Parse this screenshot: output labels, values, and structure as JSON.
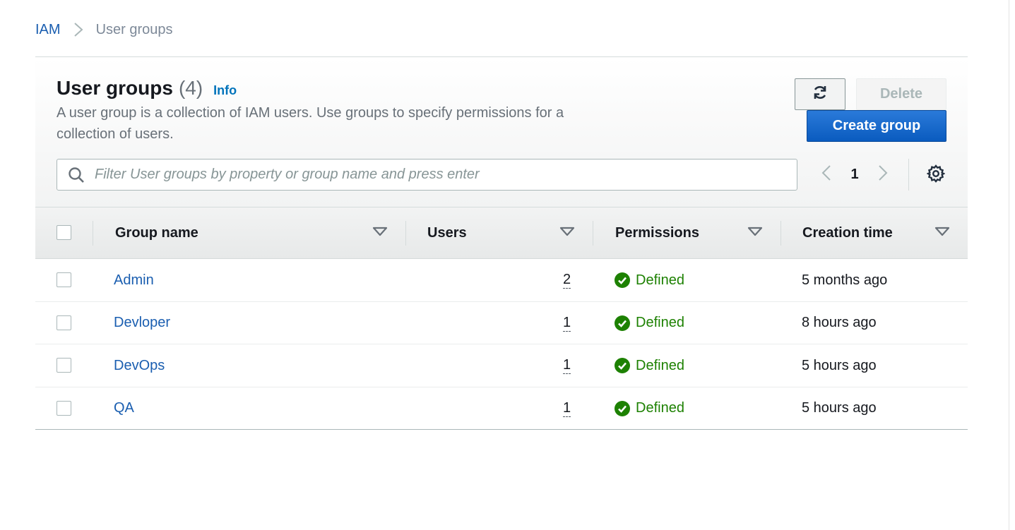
{
  "breadcrumb": {
    "root": "IAM",
    "current": "User groups"
  },
  "header": {
    "title": "User groups",
    "count": "(4)",
    "info": "Info",
    "description": "A user group is a collection of IAM users. Use groups to specify permissions for a collection of users."
  },
  "actions": {
    "refresh_icon": "refresh-icon",
    "delete_label": "Delete",
    "create_label": "Create group"
  },
  "filter": {
    "placeholder": "Filter User groups by property or group name and press enter",
    "value": ""
  },
  "pagination": {
    "current_page": "1"
  },
  "table": {
    "columns": [
      "Group name",
      "Users",
      "Permissions",
      "Creation time"
    ],
    "rows": [
      {
        "name": "Admin",
        "users": "2",
        "permissions": "Defined",
        "created": "5 months ago"
      },
      {
        "name": "Devloper",
        "users": "1",
        "permissions": "Defined",
        "created": "8 hours ago"
      },
      {
        "name": "DevOps",
        "users": "1",
        "permissions": "Defined",
        "created": "5 hours ago"
      },
      {
        "name": "QA",
        "users": "1",
        "permissions": "Defined",
        "created": "5 hours ago"
      }
    ]
  },
  "colors": {
    "link": "#1a5eb0",
    "primary_button": "#0a5bbf",
    "success": "#1d8102"
  }
}
